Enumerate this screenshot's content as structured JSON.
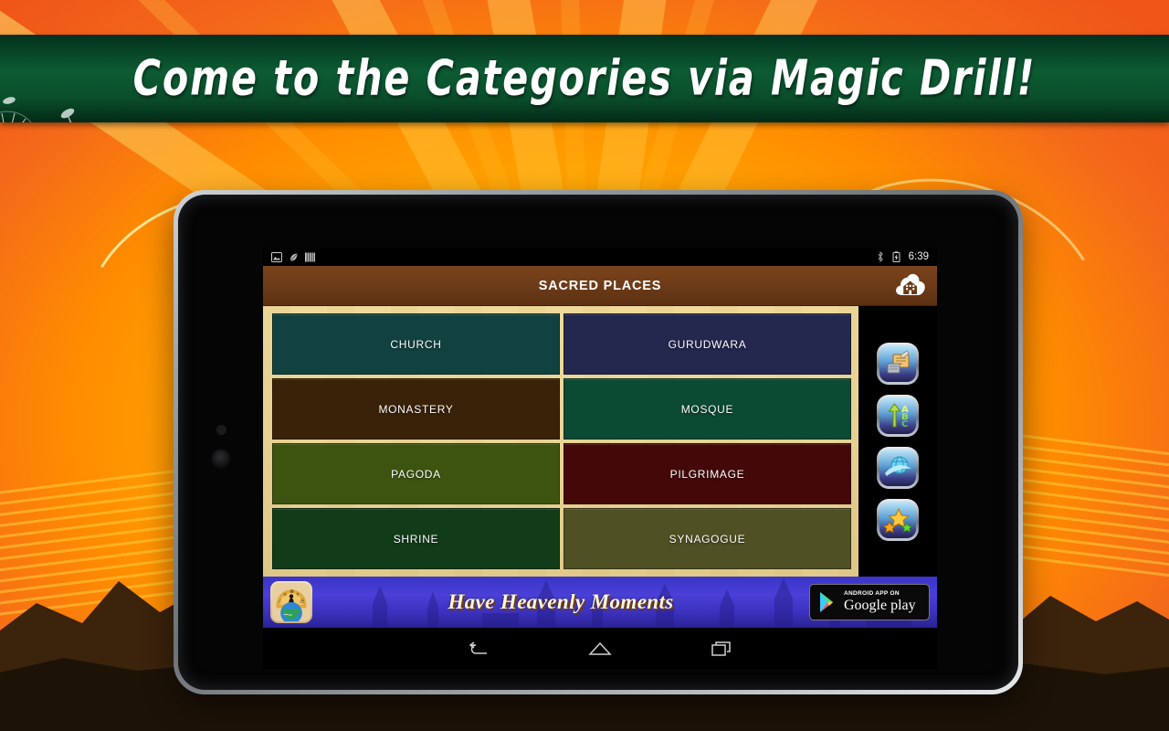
{
  "promo": {
    "headline": "Come to the Categories via Magic Drill!",
    "banner_bg": "#0c5c33",
    "decor_icon": "dandelion-icon"
  },
  "device": {
    "type": "android-tablet",
    "bezel_color": "#050505"
  },
  "status_bar": {
    "left_icons": [
      "screenshot-icon",
      "leaf-icon",
      "sim-bars-icon"
    ],
    "right_icons": [
      "bluetooth-icon",
      "battery-charging-icon"
    ],
    "clock": "6:39"
  },
  "app_bar": {
    "title": "SACRED PLACES",
    "title_bg": "#6b3a17",
    "home_icon": "cloud-home-icon"
  },
  "grid": {
    "background": "#ead69a",
    "tiles": [
      {
        "label": "CHURCH",
        "color": "#11423f"
      },
      {
        "label": "GURUDWARA",
        "color": "#24284f"
      },
      {
        "label": "MONASTERY",
        "color": "#3a2208"
      },
      {
        "label": "MOSQUE",
        "color": "#0b4a33"
      },
      {
        "label": "PAGODA",
        "color": "#3d5410"
      },
      {
        "label": "PILGRIMAGE",
        "color": "#450808"
      },
      {
        "label": "SHRINE",
        "color": "#123b1a"
      },
      {
        "label": "SYNAGOGUE",
        "color": "#4f5024"
      }
    ]
  },
  "tool_rail": {
    "buttons": [
      {
        "name": "flashcards-icon",
        "title": "Flashcards"
      },
      {
        "name": "sort-abc-icon",
        "title": "Sort A-B-C"
      },
      {
        "name": "globe-swoosh-icon",
        "title": "Explore"
      },
      {
        "name": "stars-favorite-icon",
        "title": "Favorites"
      }
    ]
  },
  "ad": {
    "headline": "Have Heavenly Moments",
    "app_icon": "globe-religions-icon",
    "store_badge_sub": "ANDROID APP ON",
    "store_badge_main": "Google play",
    "bg": "#3b31bd"
  },
  "nav_bar": {
    "buttons": [
      {
        "name": "back-icon"
      },
      {
        "name": "home-icon"
      },
      {
        "name": "recents-icon"
      }
    ]
  }
}
